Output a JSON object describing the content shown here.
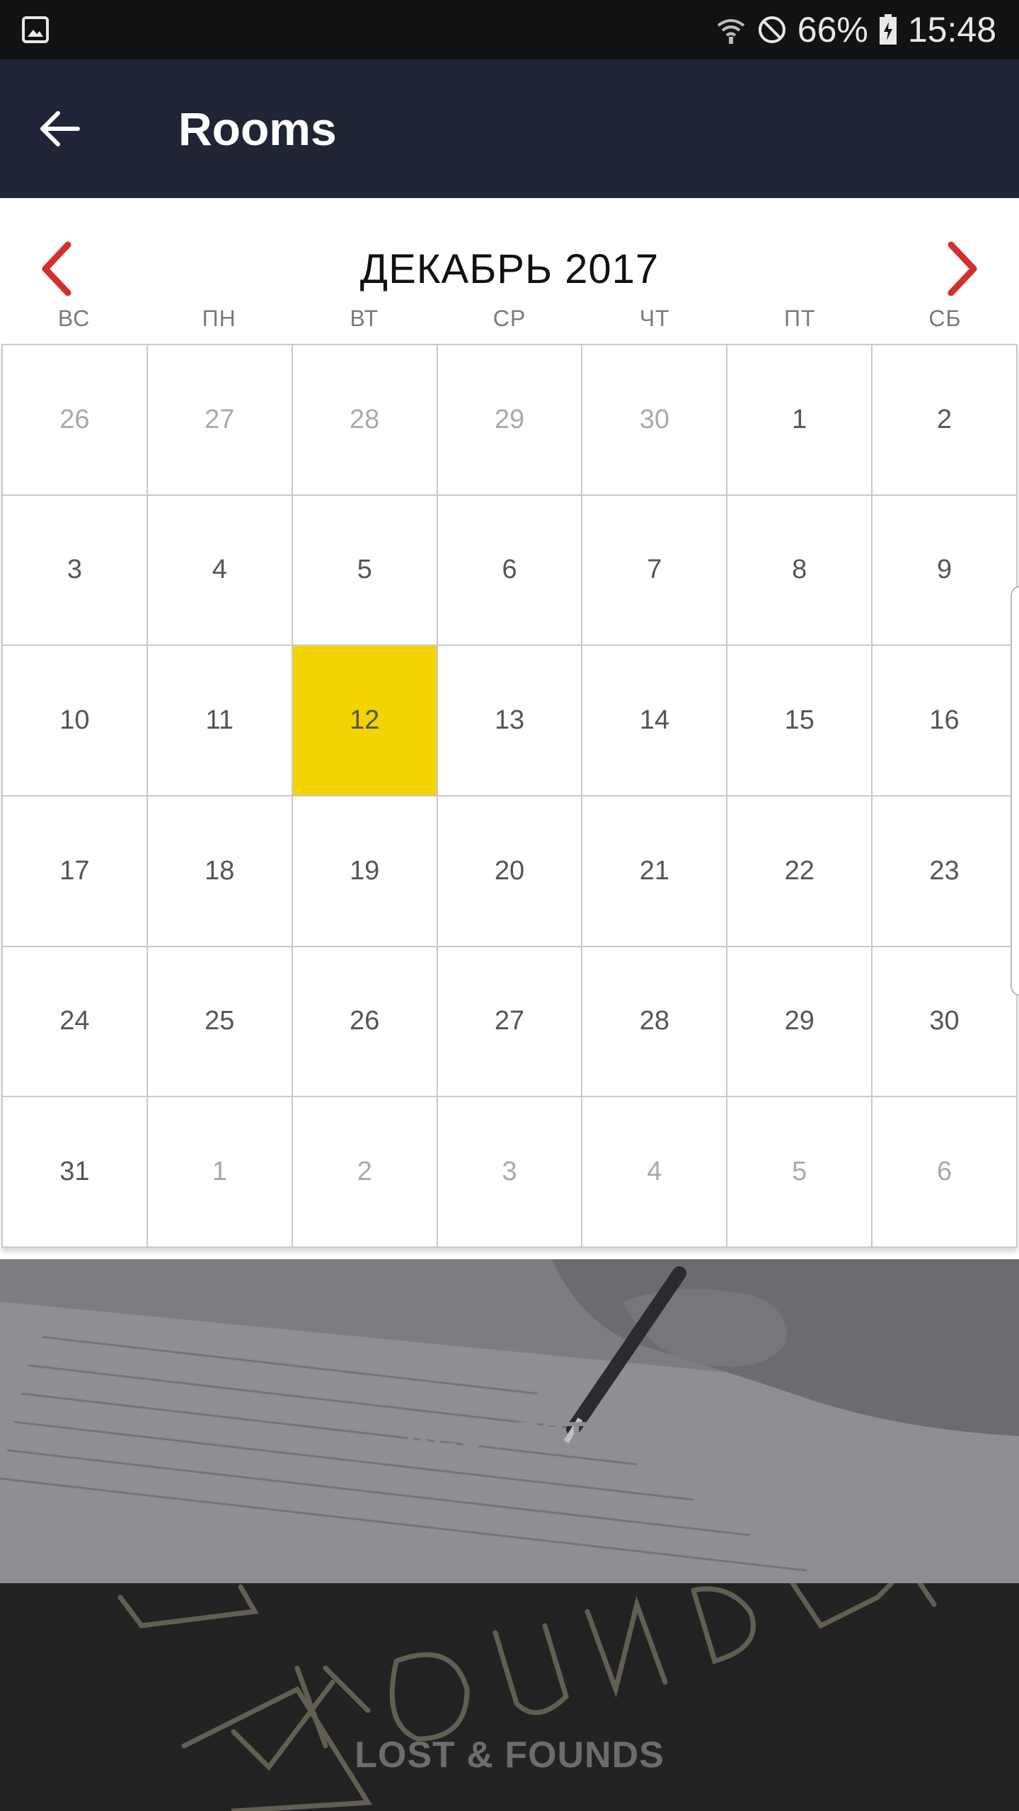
{
  "status_bar": {
    "battery": "66%",
    "time": "15:48",
    "icons": [
      "gallery-icon",
      "wifi-icon",
      "do-not-disturb-icon",
      "battery-icon"
    ]
  },
  "app_bar": {
    "title": "Rooms",
    "back_icon": "arrow-left-icon"
  },
  "calendar": {
    "month_title": "ДЕКАБРЬ 2017",
    "prev_icon": "chevron-left-icon",
    "next_icon": "chevron-right-icon",
    "accent_color": "#d32f2f",
    "selected_color": "#f2d500",
    "weekdays": [
      "ВС",
      "ПН",
      "ВТ",
      "СР",
      "ЧТ",
      "ПТ",
      "СБ"
    ],
    "days": [
      {
        "label": "26",
        "muted": true
      },
      {
        "label": "27",
        "muted": true
      },
      {
        "label": "28",
        "muted": true
      },
      {
        "label": "29",
        "muted": true
      },
      {
        "label": "30",
        "muted": true
      },
      {
        "label": "1"
      },
      {
        "label": "2"
      },
      {
        "label": "3"
      },
      {
        "label": "4"
      },
      {
        "label": "5"
      },
      {
        "label": "6"
      },
      {
        "label": "7"
      },
      {
        "label": "8"
      },
      {
        "label": "9"
      },
      {
        "label": "10"
      },
      {
        "label": "11"
      },
      {
        "label": "12",
        "selected": true
      },
      {
        "label": "13"
      },
      {
        "label": "14"
      },
      {
        "label": "15"
      },
      {
        "label": "16"
      },
      {
        "label": "17"
      },
      {
        "label": "18"
      },
      {
        "label": "19"
      },
      {
        "label": "20"
      },
      {
        "label": "21"
      },
      {
        "label": "22"
      },
      {
        "label": "23"
      },
      {
        "label": "24"
      },
      {
        "label": "25"
      },
      {
        "label": "26"
      },
      {
        "label": "27"
      },
      {
        "label": "28"
      },
      {
        "label": "29"
      },
      {
        "label": "30"
      },
      {
        "label": "31"
      },
      {
        "label": "1",
        "muted": true
      },
      {
        "label": "2",
        "muted": true
      },
      {
        "label": "3",
        "muted": true
      },
      {
        "label": "4",
        "muted": true
      },
      {
        "label": "5",
        "muted": true
      },
      {
        "label": "6",
        "muted": true
      }
    ]
  },
  "tiles": {
    "requests": "REQUESTS",
    "lost_found": "LOST & FOUNDS"
  }
}
